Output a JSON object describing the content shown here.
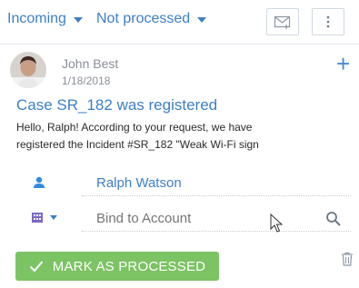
{
  "filters": {
    "direction_label": "Incoming",
    "status_label": "Not processed"
  },
  "toolbar": {
    "new_email_icon": "new-email-icon",
    "more_icon": "vertical-dots-icon"
  },
  "message": {
    "sender": "John Best",
    "date": "1/18/2018",
    "subject": "Case SR_182 was registered",
    "body_line1": "Hello, Ralph! According to your request, we have",
    "body_line2": "registered the Incident #SR_182 \"Weak Wi-Fi sign"
  },
  "fields": {
    "contact_value": "Ralph Watson",
    "account_placeholder": "Bind to Account"
  },
  "actions": {
    "mark_processed_label": "MARK AS PROCESSED"
  },
  "colors": {
    "link": "#3d7fc8",
    "accent_button": "#7cc363",
    "contact_icon": "#2f8be0",
    "account_icon": "#7a68c7"
  }
}
